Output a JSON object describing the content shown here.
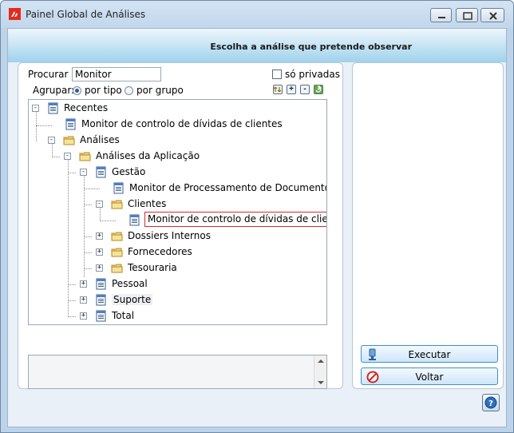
{
  "window": {
    "title": "Painel Global de Análises"
  },
  "header": {
    "instruction": "Escolha a análise que pretende observar"
  },
  "search": {
    "label": "Procurar :",
    "value": "Monitor"
  },
  "filters": {
    "private_only_label": "só privadas",
    "group_label": "Agrupar:",
    "by_type_label": "por tipo",
    "by_group_label": "por grupo",
    "selected": "por tipo"
  },
  "tree": {
    "nodes": [
      {
        "label": "Recentes",
        "icon": "report-icon",
        "expander": "minus"
      },
      {
        "label": "Monitor de controlo de dívidas de clientes",
        "icon": "report-icon"
      },
      {
        "label": "Análises",
        "icon": "folder-icon",
        "expander": "minus"
      },
      {
        "label": "Análises da Aplicação",
        "icon": "folder-icon",
        "expander": "minus"
      },
      {
        "label": "Gestão",
        "icon": "report-icon",
        "expander": "minus"
      },
      {
        "label": "Monitor de Processamento de Documentos",
        "icon": "report-icon"
      },
      {
        "label": "Clientes",
        "icon": "folder-icon",
        "expander": "minus"
      },
      {
        "label": "Monitor de controlo de dívidas de clientes",
        "icon": "report-icon",
        "selected": true
      },
      {
        "label": "Dossiers Internos",
        "icon": "folder-icon",
        "expander": "plus"
      },
      {
        "label": "Fornecedores",
        "icon": "folder-icon",
        "expander": "plus"
      },
      {
        "label": "Tesouraria",
        "icon": "folder-icon",
        "expander": "plus"
      },
      {
        "label": "Pessoal",
        "icon": "report-icon",
        "expander": "plus"
      },
      {
        "label": "Suporte",
        "icon": "report-icon",
        "expander": "plus",
        "hover": true
      },
      {
        "label": "Total",
        "icon": "report-icon",
        "expander": "plus"
      }
    ]
  },
  "actions": {
    "execute_label": "Executar",
    "back_label": "Voltar"
  },
  "colors": {
    "selection_outline": "#d72b2b",
    "button_border": "#3c8fd1",
    "header_gradient_end": "#9fd2ec"
  }
}
